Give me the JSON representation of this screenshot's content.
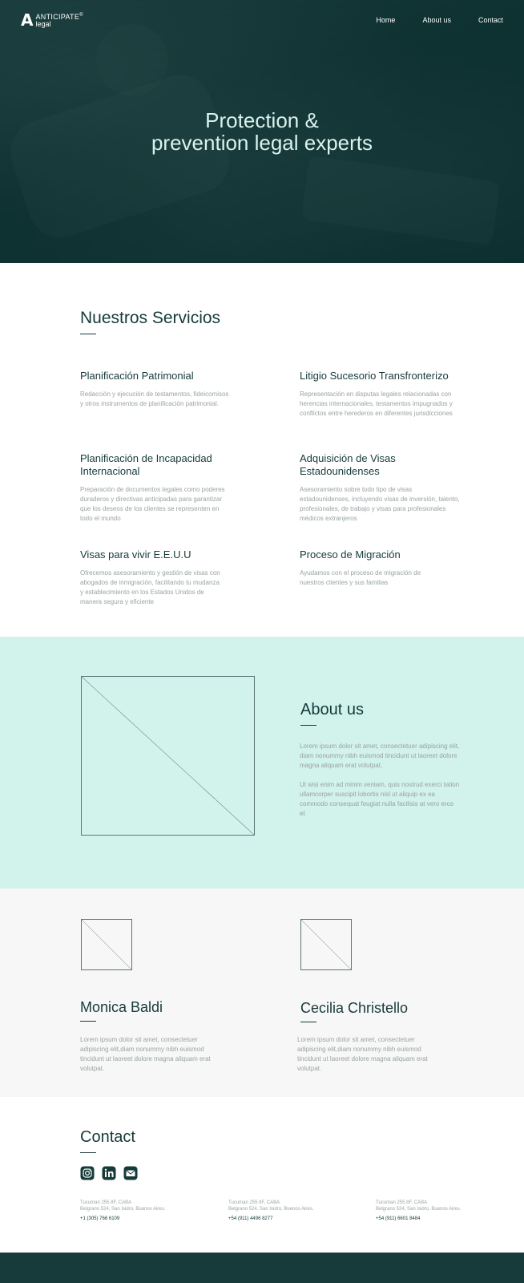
{
  "nav": {
    "logo_mark": "A",
    "logo_name": "ANTICIPATE",
    "logo_reg": "®",
    "logo_sub": "legal",
    "links": [
      "Home",
      "About us",
      "Contact"
    ]
  },
  "hero": {
    "title_line1": "Protection &",
    "title_line2": "prevention legal experts"
  },
  "services": {
    "title": "Nuestros Servicios",
    "items": [
      {
        "title": "Planificación Patrimonial",
        "desc": "Redacción y ejecución de testamentos, fideicomisos y otros instrumentos de planificación patrimonial."
      },
      {
        "title": "Litigio Sucesorio Transfronterizo",
        "desc": "Representación en disputas legales relacionadas con herencias internacionales, testamentos impugnados y conflictos entre herederos en diferentes jurisdicciones"
      },
      {
        "title": "Planificación de Incapacidad Internacional",
        "desc": "Preparación de documentos legales como poderes duraderos y directivas anticipadas para garantizar que los deseos de los clientes se representen en todo el mundo"
      },
      {
        "title": "Adquisición de Visas Estadounidenses",
        "desc": "Asesoramiento sobre todo tipo de visas estadounidenses, incluyendo visas de inversión, talento, profesionales, de trabajo y visas para profesionales médicos extranjeros"
      },
      {
        "title": "Visas para vivir E.E.U.U",
        "desc": "Ofrecemos asesoramiento y gestión de visas con abogados de inmigración, facilitando tu mudanza y establecimiento en los Estados Unidos de manera segura y eficiente"
      },
      {
        "title": "Proceso de Migración",
        "desc": "Ayudamos con el proceso de migración de nuestros clientes y sus familias"
      }
    ]
  },
  "about": {
    "title": "About us",
    "paragraph1": "Lorem ipsum dolor sit amet, consectetuer adipiscing elit, diam nonummy nibh euismod tincidunt ut laoreet dolore magna aliquam erat volutpat.",
    "paragraph2": "Ut wisi enim ad minim veniam, quis nostrud exerci tation ullamcorper suscipit lobortis nisl ut aliquip ex ea commodo consequat feugiat nulla facilisis at vero eros et"
  },
  "team": {
    "members": [
      {
        "name": "Monica Baldi",
        "bio": "Lorem ipsum dolor sit amet, consectetuer adipiscing elit,diam nonummy nibh euismod tincidunt ut laoreet dolore magna aliquam erat volutpat."
      },
      {
        "name": "Cecilia Christello",
        "bio": "Lorem ipsum dolor sit amet, consectetuer adipiscing elit,diam nonummy nibh euismod tincidunt ut laoreet dolore magna aliquam erat volutpat."
      }
    ]
  },
  "contact": {
    "title": "Contact",
    "socials": [
      "instagram-icon",
      "linkedin-icon",
      "mail-icon"
    ],
    "offices": [
      {
        "addr1": "Tucuman 255 8F, CABA",
        "addr2": "Belgrano 524, San Isidro, Buenos Aires.",
        "phone": "+1 (305) 766 6109"
      },
      {
        "addr1": "Tucuman 255 8F, CABA",
        "addr2": "Belgrano 524, San Isidro, Buenos Aires.",
        "phone": "+54 (911) 4496 8277"
      },
      {
        "addr1": "Tucuman 255 8F, CABA",
        "addr2": "Belgrano 524, San Isidro, Buenos Aires.",
        "phone": "+54 (911) 6601 8484"
      }
    ]
  },
  "colors": {
    "primary": "#163a3a",
    "about_bg": "#d2f2ec",
    "team_bg": "#f7f7f7",
    "hero_text": "#d9f2ee",
    "muted_text": "#9aa3a3"
  }
}
